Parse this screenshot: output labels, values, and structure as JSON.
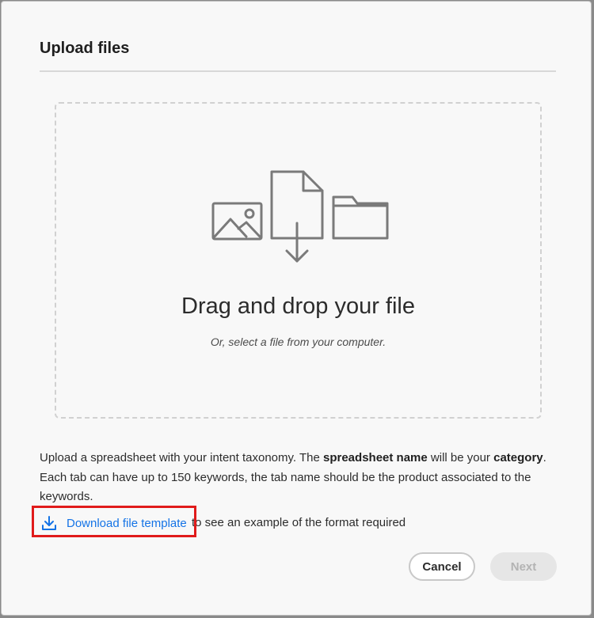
{
  "dialog": {
    "title": "Upload files"
  },
  "dropzone": {
    "title": "Drag and drop your file",
    "subtitle": "Or, select a file from your computer.",
    "icons": [
      "image-icon",
      "file-download-icon",
      "folder-icon"
    ]
  },
  "description": {
    "part1": "Upload a spreadsheet with your intent taxonomy. The ",
    "bold1": "spreadsheet name",
    "part2": " will be your ",
    "bold2": "category",
    "part3": ". Each tab can have up to 150 keywords, the tab name should be the product associated to the keywords."
  },
  "download": {
    "link_label": "Download file template",
    "suffix": "to see an example of the format required",
    "icon": "download-icon"
  },
  "buttons": {
    "cancel": "Cancel",
    "next": "Next"
  },
  "colors": {
    "link": "#1473e6",
    "highlight": "#e01b1b",
    "disabled_text": "#b3b3b3"
  }
}
